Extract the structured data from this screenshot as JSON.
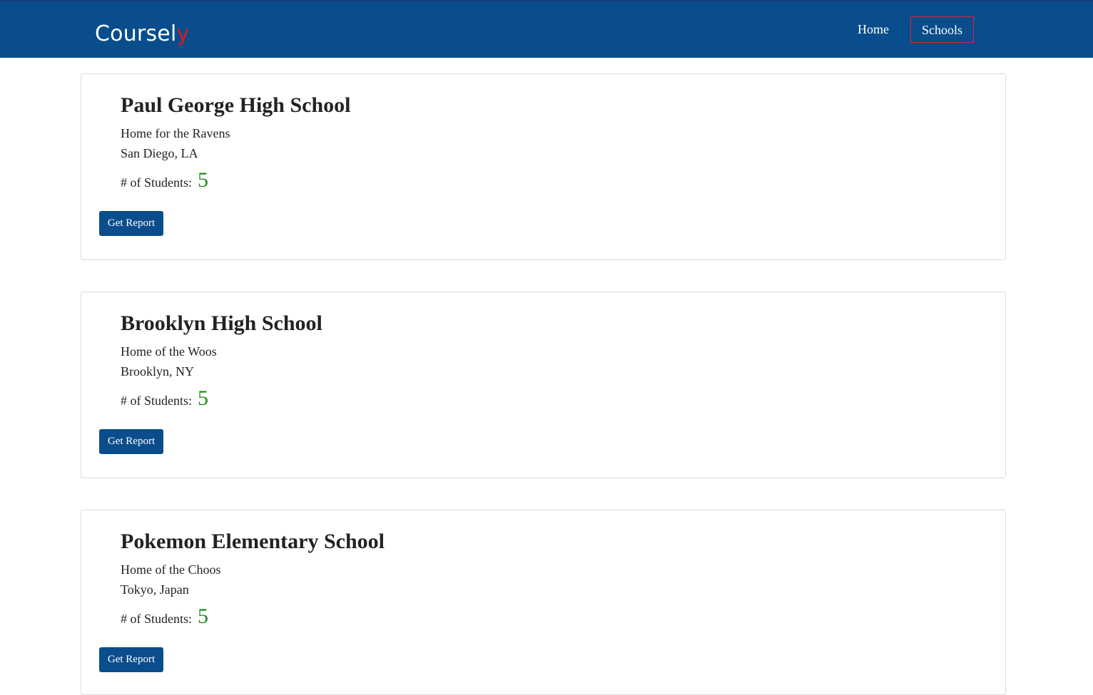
{
  "navbar": {
    "brand_main": "Course",
    "brand_l": "l",
    "brand_accent": "y",
    "links": [
      {
        "label": "Home"
      },
      {
        "label": "Schools"
      }
    ]
  },
  "colors": {
    "navbar_bg": "#0a4d8c",
    "brand_accent": "#e0151b",
    "active_link_border": "#d9243b",
    "student_count": "#1d8a1d",
    "button_bg": "#0a4d8c"
  },
  "schools": [
    {
      "name": "Paul George High School",
      "tagline": "Home for the Ravens",
      "location": "San Diego, LA",
      "students_label": "# of Students:",
      "students_count": "5",
      "button_label": "Get Report"
    },
    {
      "name": "Brooklyn High School",
      "tagline": "Home of the Woos",
      "location": "Brooklyn, NY",
      "students_label": "# of Students:",
      "students_count": "5",
      "button_label": "Get Report"
    },
    {
      "name": "Pokemon Elementary School",
      "tagline": "Home of the Choos",
      "location": "Tokyo, Japan",
      "students_label": "# of Students:",
      "students_count": "5",
      "button_label": "Get Report"
    }
  ]
}
